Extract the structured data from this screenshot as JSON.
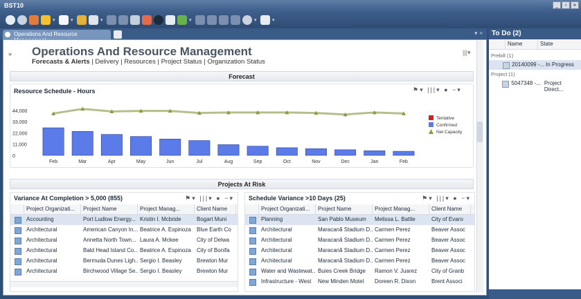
{
  "window": {
    "title": "BST10",
    "controls": [
      "_",
      "▫",
      "×"
    ]
  },
  "tab": {
    "label": "Operations And Resource Management"
  },
  "page": {
    "title": "Operations And Resource Management",
    "nav_active": "Forecasts & Alerts",
    "nav": [
      "| Delivery",
      "| Resources",
      "| Project Status",
      "| Organization Status"
    ]
  },
  "forecast": {
    "section": "Forecast",
    "chart_title": "Resource Schedule - Hours"
  },
  "chart_data": {
    "type": "bar",
    "title": "Resource Schedule - Hours",
    "categories": [
      "Feb",
      "Mar",
      "Apr",
      "May",
      "Jun",
      "Jul",
      "Aug",
      "Sep",
      "Oct",
      "Nov",
      "Dec",
      "Jan",
      "Feb"
    ],
    "yticks": [
      "44,000",
      "33,000",
      "22,000",
      "11,000",
      "0"
    ],
    "ylim": [
      0,
      48000
    ],
    "series": [
      {
        "name": "Tentative",
        "color": "#cc2222",
        "values": [
          0,
          0,
          0,
          0,
          0,
          0,
          0,
          0,
          0,
          0,
          0,
          0,
          0
        ]
      },
      {
        "name": "Confirmed",
        "color": "#5b7be8",
        "values": [
          27000,
          23500,
          20500,
          18500,
          16000,
          14500,
          10500,
          9000,
          7500,
          6500,
          5500,
          4500,
          4000
        ]
      },
      {
        "name": "Net Capacity",
        "color": "#8a9a3c",
        "values": [
          41000,
          45500,
          43000,
          43500,
          43500,
          41500,
          42000,
          42000,
          42000,
          41500,
          40000,
          42000,
          41000
        ]
      }
    ],
    "legend_position": "right"
  },
  "risk": {
    "section": "Projects At Risk"
  },
  "grid1": {
    "title": "Variance At Completion > 5,000 (855)",
    "columns": [
      "Project Organizati...",
      "Project Name",
      "Project Manag...",
      "Client Name"
    ],
    "rows": [
      [
        "Accounting",
        "Port Ludlow Energy...",
        "Kristin I. Mcbride",
        "Bogart Muni"
      ],
      [
        "Architectural",
        "American Canyon In...",
        "Beatrice A. Espinoza",
        "Blue Earth Co"
      ],
      [
        "Architectural",
        "Annetta North Town...",
        "Laura A. Mckee",
        "City of Delwa"
      ],
      [
        "Architectural",
        "Bald Head Island Co...",
        "Beatrice A. Espinoza",
        "City of Bonifa"
      ],
      [
        "Architectural",
        "Bermuda Dunes Ligh...",
        "Sergio I. Beasley",
        "Brewton Mur"
      ],
      [
        "Architectural",
        "Birchwood Village Se...",
        "Sergio I. Beasley",
        "Brewton Mur"
      ]
    ]
  },
  "grid2": {
    "title": "Schedule Variance >10 Days (25)",
    "columns": [
      "Project Organizati...",
      "Project Name",
      "Project Manag...",
      "Client Name"
    ],
    "rows": [
      [
        "Planning",
        "San Pablo Museum",
        "Melissa L. Battle",
        "City of Evaro"
      ],
      [
        "Architectural",
        "Maracanã Stadium D...",
        "Carmen Perez",
        "Beaver Assoc"
      ],
      [
        "Architectural",
        "Maracanã Stadium D...",
        "Carmen Perez",
        "Beaver Assoc"
      ],
      [
        "Architectural",
        "Maracanã Stadium D...",
        "Carmen Perez",
        "Beaver Assoc"
      ],
      [
        "Architectural",
        "Maracanã Stadium D...",
        "Carmen Perez",
        "Beaver Assoc"
      ],
      [
        "Water and Wastewat...",
        "Buies Creek Bridge",
        "Ramon V. Juarez",
        "City of Granb"
      ],
      [
        "Infrastructure - West",
        "New Minden Motel",
        "Doreen R. Dixon",
        "Brent Associ"
      ]
    ]
  },
  "todo": {
    "title": "To Do (2)",
    "columns": [
      "Name",
      "State"
    ],
    "groups": [
      {
        "label": "Prebill (1)",
        "item_name": "20140099 -...",
        "item_state": "In Progress"
      },
      {
        "label": "Project (1)",
        "item_name": "5047348 -...",
        "item_state": "Project Direct..."
      }
    ]
  }
}
